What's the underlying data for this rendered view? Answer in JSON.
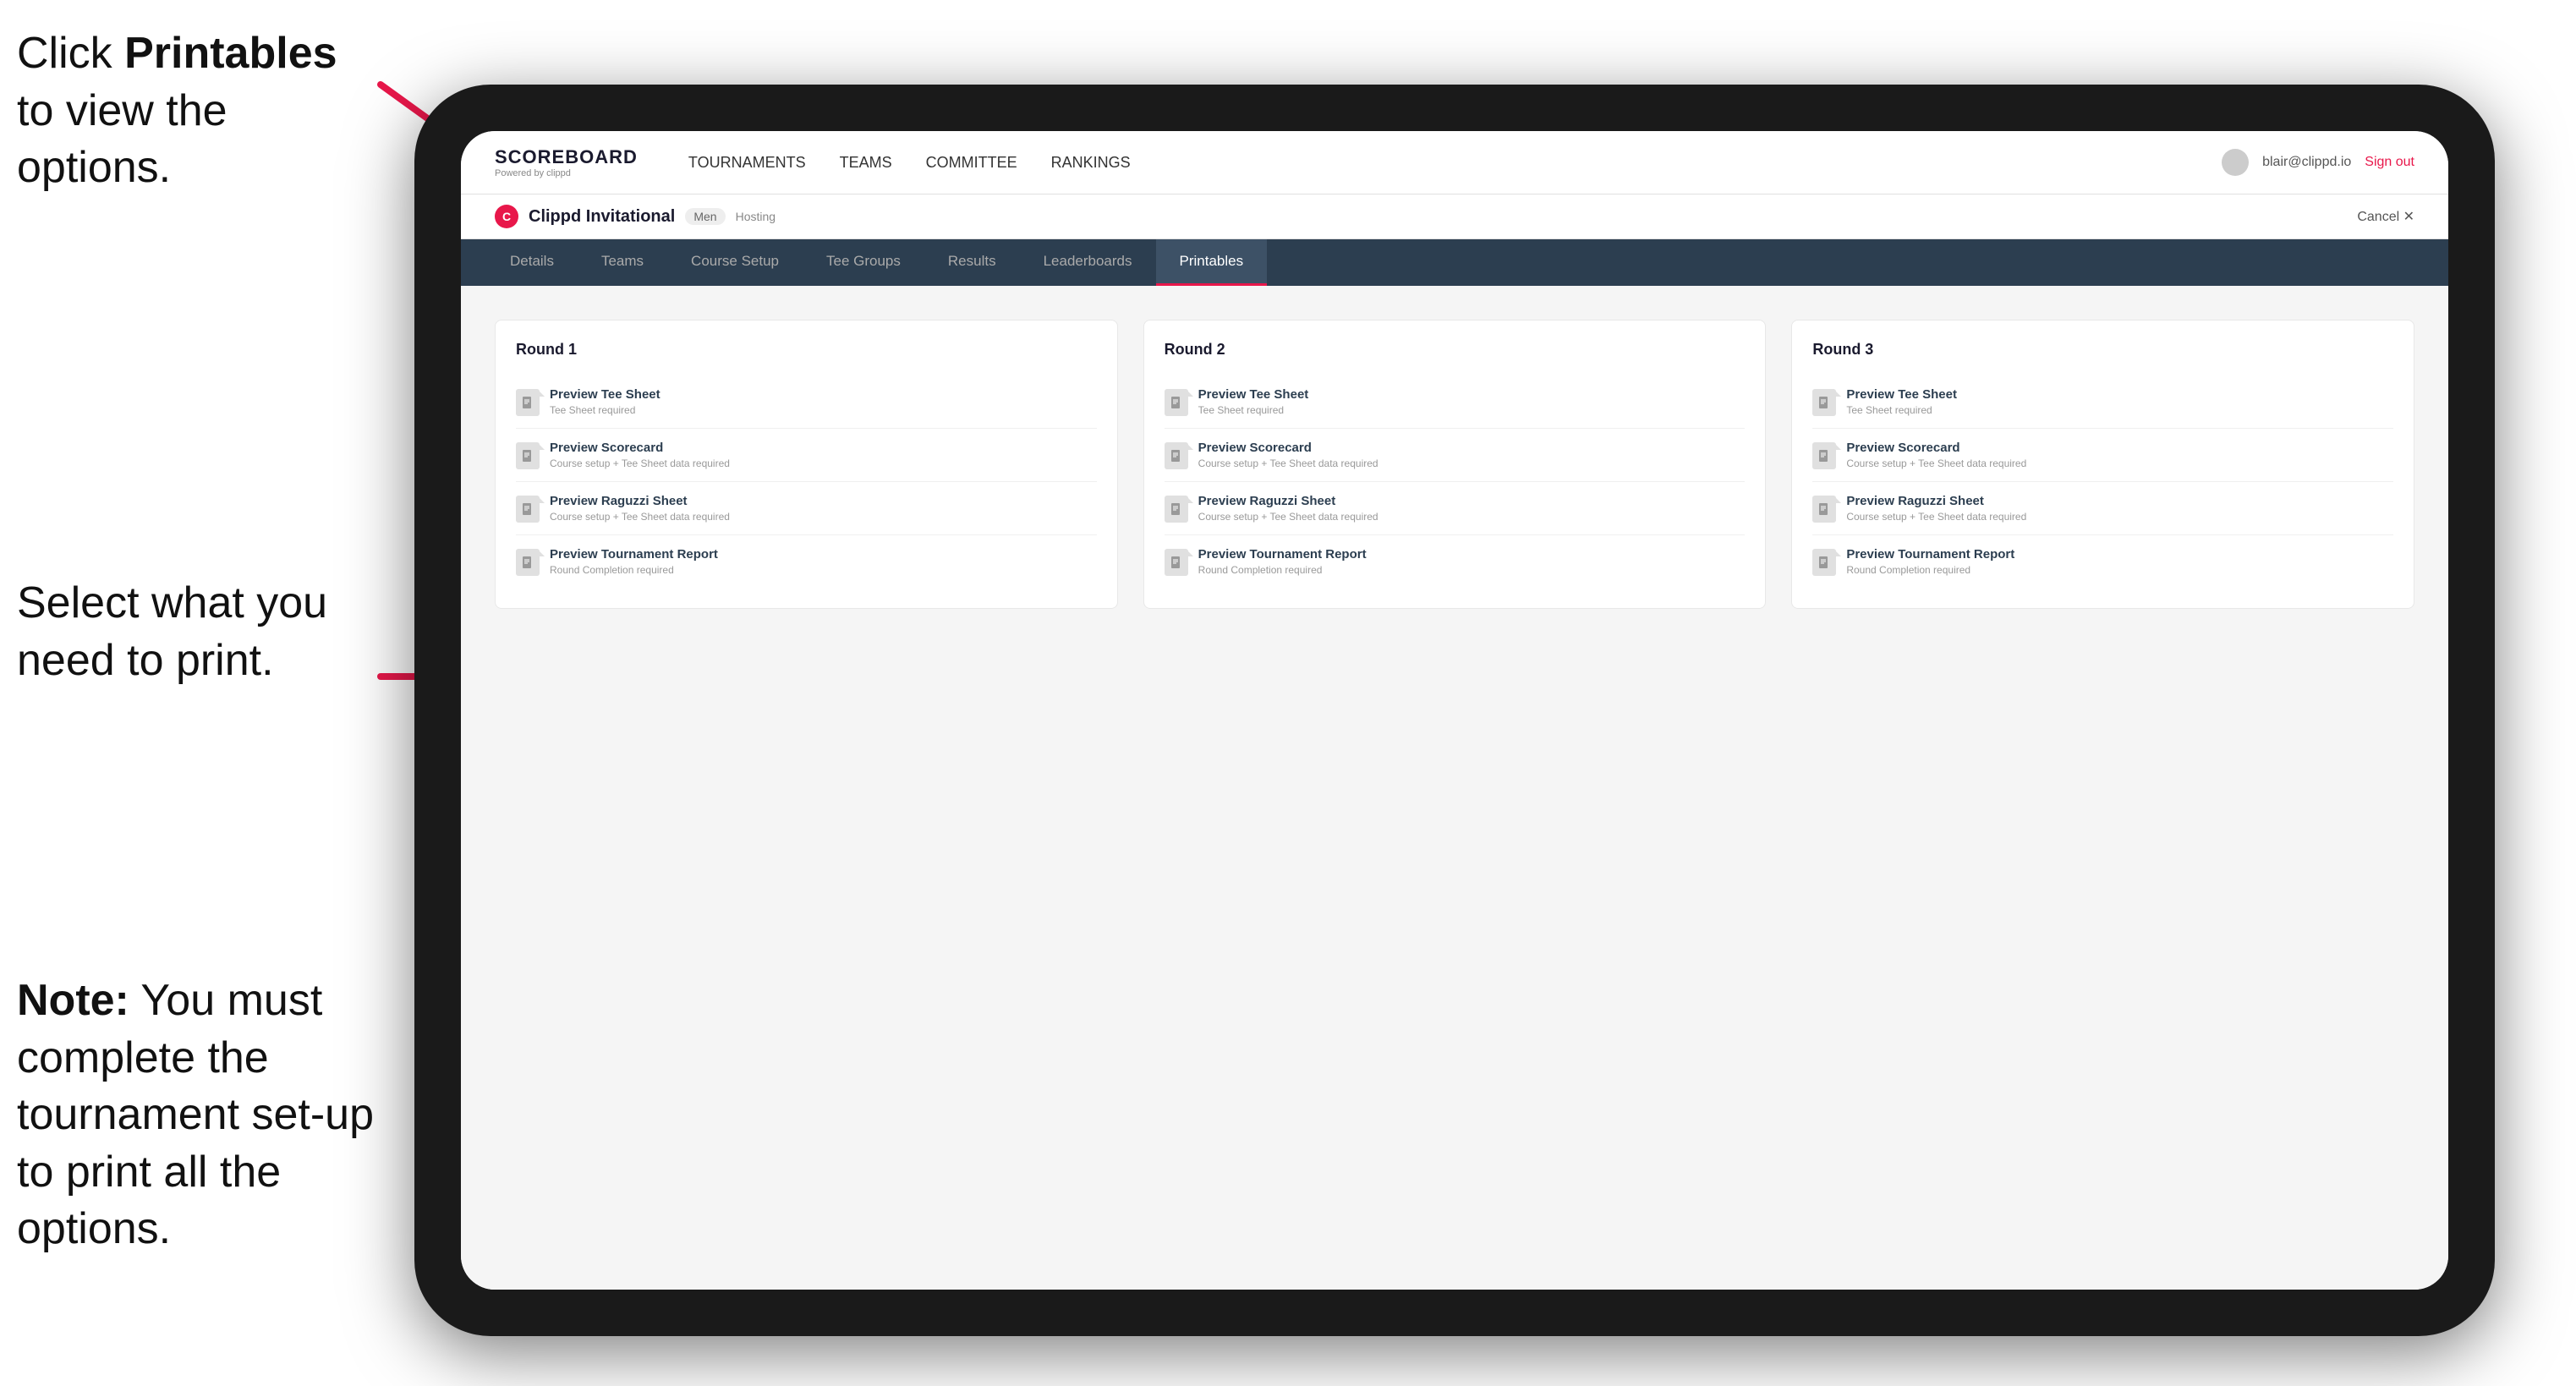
{
  "instructions": {
    "top": {
      "text_prefix": "Click ",
      "bold": "Printables",
      "text_suffix": " to view the options."
    },
    "middle": {
      "text": "Select what you need to print."
    },
    "bottom": {
      "text_prefix": "Note:",
      "text_suffix": " You must complete the tournament set-up to print all the options."
    }
  },
  "nav": {
    "logo_title": "SCOREBOARD",
    "logo_sub": "Powered by clippd",
    "items": [
      "TOURNAMENTS",
      "TEAMS",
      "COMMITTEE",
      "RANKINGS"
    ],
    "user_email": "blair@clippd.io",
    "sign_out": "Sign out"
  },
  "tournament": {
    "initial": "C",
    "name": "Clippd Invitational",
    "division": "Men",
    "status": "Hosting",
    "cancel": "Cancel ✕"
  },
  "tabs": [
    {
      "label": "Details",
      "active": false
    },
    {
      "label": "Teams",
      "active": false
    },
    {
      "label": "Course Setup",
      "active": false
    },
    {
      "label": "Tee Groups",
      "active": false
    },
    {
      "label": "Results",
      "active": false
    },
    {
      "label": "Leaderboards",
      "active": false
    },
    {
      "label": "Printables",
      "active": true
    }
  ],
  "rounds": [
    {
      "title": "Round 1",
      "items": [
        {
          "title": "Preview Tee Sheet",
          "subtitle": "Tee Sheet required"
        },
        {
          "title": "Preview Scorecard",
          "subtitle": "Course setup + Tee Sheet data required"
        },
        {
          "title": "Preview Raguzzi Sheet",
          "subtitle": "Course setup + Tee Sheet data required"
        },
        {
          "title": "Preview Tournament Report",
          "subtitle": "Round Completion required"
        }
      ]
    },
    {
      "title": "Round 2",
      "items": [
        {
          "title": "Preview Tee Sheet",
          "subtitle": "Tee Sheet required"
        },
        {
          "title": "Preview Scorecard",
          "subtitle": "Course setup + Tee Sheet data required"
        },
        {
          "title": "Preview Raguzzi Sheet",
          "subtitle": "Course setup + Tee Sheet data required"
        },
        {
          "title": "Preview Tournament Report",
          "subtitle": "Round Completion required"
        }
      ]
    },
    {
      "title": "Round 3",
      "items": [
        {
          "title": "Preview Tee Sheet",
          "subtitle": "Tee Sheet required"
        },
        {
          "title": "Preview Scorecard",
          "subtitle": "Course setup + Tee Sheet data required"
        },
        {
          "title": "Preview Raguzzi Sheet",
          "subtitle": "Course setup + Tee Sheet data required"
        },
        {
          "title": "Preview Tournament Report",
          "subtitle": "Round Completion required"
        }
      ]
    }
  ]
}
